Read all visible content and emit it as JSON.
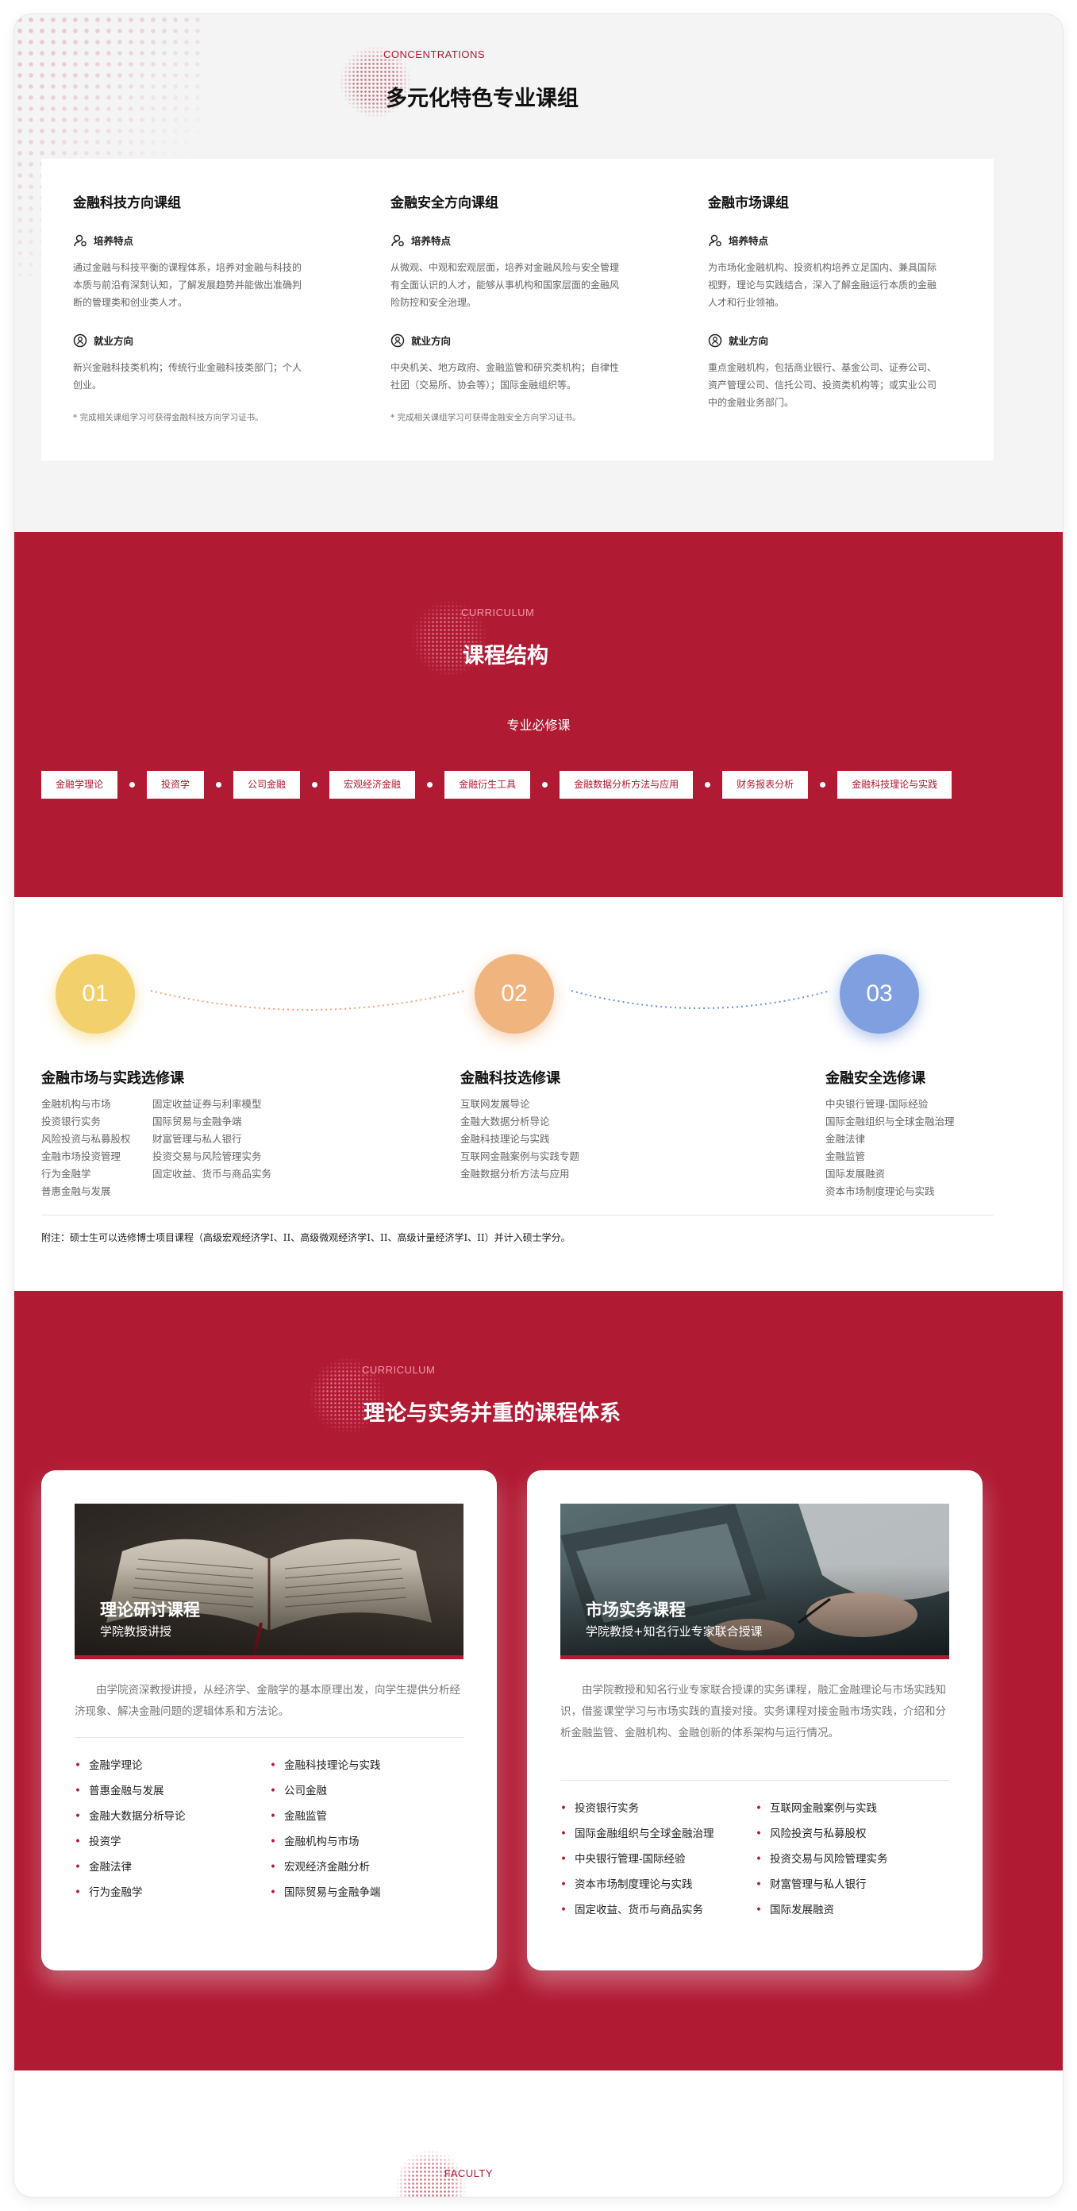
{
  "concentrations": {
    "eyebrow": "CONCENTRATIONS",
    "title": "多元化特色专业课组",
    "columns": [
      {
        "title": "金融科技方向课组",
        "training_label": "培养特点",
        "training_text": "通过金融与科技平衡的课程体系，培养对金融与科技的本质与前沿有深刻认知，了解发展趋势并能做出准确判断的管理类和创业类人才。",
        "career_label": "就业方向",
        "career_text": "新兴金融科技类机构；传统行业金融科技类部门；个人创业。",
        "note": "* 完成相关课组学习可获得金融科技方向学习证书。"
      },
      {
        "title": "金融安全方向课组",
        "training_label": "培养特点",
        "training_text": "从微观、中观和宏观层面，培养对金融风险与安全管理有全面认识的人才，能够从事机构和国家层面的金融风险防控和安全治理。",
        "career_label": "就业方向",
        "career_text": "中央机关、地方政府、金融监管和研究类机构；自律性社团（交易所、协会等）；国际金融组织等。",
        "note": "* 完成相关课组学习可获得金融安全方向学习证书。"
      },
      {
        "title": "金融市场课组",
        "training_label": "培养特点",
        "training_text": "为市场化金融机构、投资机构培养立足国内、兼具国际视野，理论与实践结合，深入了解金融运行本质的金融人才和行业领袖。",
        "career_label": "就业方向",
        "career_text": "重点金融机构，包括商业银行、基金公司、证券公司、资产管理公司、信托公司、投资类机构等；或实业公司中的金融业务部门。",
        "note": ""
      }
    ]
  },
  "curriculum": {
    "eyebrow": "CURRICULUM",
    "title": "课程结构",
    "required_label": "专业必修课",
    "required_courses": [
      "金融学理论",
      "投资学",
      "公司金融",
      "宏观经济金融",
      "金融衍生工具",
      "金融数据分析方法与应用",
      "财务报表分析",
      "金融科技理论与实践"
    ]
  },
  "electives": [
    {
      "num": "01",
      "title": "金融市场与实践选修课",
      "col1": [
        "金融机构与市场",
        "投资银行实务",
        "风险投资与私募股权",
        "金融市场投资管理",
        "行为金融学",
        "普惠金融与发展"
      ],
      "col2": [
        "固定收益证券与利率模型",
        "国际贸易与金融争端",
        "财富管理与私人银行",
        "投资交易与风险管理实务",
        "固定收益、货币与商品实务"
      ]
    },
    {
      "num": "02",
      "title": "金融科技选修课",
      "col1": [
        "互联网发展导论",
        "金融大数据分析导论",
        "金融科技理论与实践",
        "互联网金融案例与实践专题",
        "金融数据分析方法与应用"
      ],
      "col2": []
    },
    {
      "num": "03",
      "title": "金融安全选修课",
      "col1": [
        "中央银行管理-国际经验",
        "国际金融组织与全球金融治理",
        "金融法律",
        "金融监管",
        "国际发展融资",
        "资本市场制度理论与实践"
      ],
      "col2": []
    }
  ],
  "elective_note": "附注：硕士生可以选修博士项目课程（高级宏观经济学I、II、高级微观经济学I、II、高级计量经济学I、II）并计入硕士学分。",
  "practice": {
    "eyebrow": "CURRICULUM",
    "title": "理论与实务并重的课程体系",
    "cards": [
      {
        "image": "open-book-photo",
        "title": "理论研讨课程",
        "subtitle": "学院教授讲授",
        "description": "由学院资深教授讲授，从经济学、金融学的基本原理出发，向学生提供分析经济现象、解决金融问题的逻辑体系和方法论。",
        "col1": [
          "金融学理论",
          "普惠金融与发展",
          "金融大数据分析导论",
          "投资学",
          "金融法律",
          "行为金融学"
        ],
        "col2": [
          "金融科技理论与实践",
          "公司金融",
          "金融监管",
          "金融机构与市场",
          "宏观经济金融分析",
          "国际贸易与金融争端"
        ]
      },
      {
        "image": "laptop-hands-photo",
        "title": "市场实务课程",
        "subtitle": "学院教授+知名行业专家联合授课",
        "description": "由学院教授和知名行业专家联合授课的实务课程，融汇金融理论与市场实践知识，借鉴课堂学习与市场实践的直接对接。实务课程对接金融市场实践，介绍和分析金融监管、金融机构、金融创新的体系架构与运行情况。",
        "col1": [
          "投资银行实务",
          "国际金融组织与全球金融治理",
          "中央银行管理-国际经验",
          "资本市场制度理论与实践",
          "固定收益、货币与商品实务"
        ],
        "col2": [
          "互联网金融案例与实践",
          "风险投资与私募股权",
          "投资交易与风险管理实务",
          "财富管理与私人银行",
          "国际发展融资"
        ]
      }
    ]
  },
  "faculty": {
    "eyebrow": "FACULTY"
  },
  "colors": {
    "accent": "#b11a33",
    "circle1": "#f2d06b",
    "circle2": "#f0b47e",
    "circle3": "#7f9fe0"
  }
}
